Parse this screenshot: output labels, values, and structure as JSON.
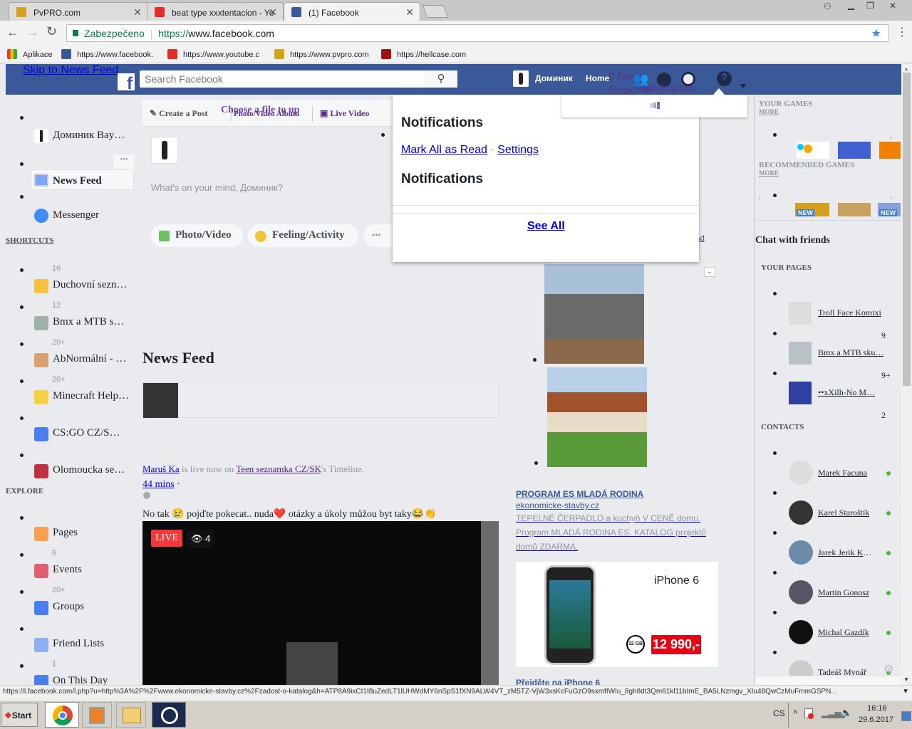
{
  "browser": {
    "tabs": [
      {
        "title": "PvPRO.com"
      },
      {
        "title": "beat type xxxtentacion - Yo"
      },
      {
        "title": "(1) Facebook"
      }
    ],
    "secure_label": "Zabezpečeno",
    "url_scheme": "https://",
    "url_rest": "www.facebook.com",
    "bookmarks": [
      {
        "label": "Aplikace"
      },
      {
        "label": "https://www.facebook."
      },
      {
        "label": "https://www.youtube.c"
      },
      {
        "label": "https://www.pvpro.com"
      },
      {
        "label": "https://hellcase.com"
      }
    ],
    "status_url": "https://l.facebook.com/l.php?u=http%3A%2F%2Fwww.ekonomicke-stavby.cz%2Fzadost-o-katalog&h=ATP8A9ixCI1t8uZedLT1lUHWdMY6nSpS1fXN9ALW4VT_zM5TZ-VjW3xsKcFuGzO9sxmfIWIu_8gh8dt3Qm61kl11bImE_BA5LNzmgv_XIu48QwCzMuFmmGSPN..."
  },
  "facebook": {
    "skip_link": "Skip to News Feed",
    "search_placeholder": "Search Facebook",
    "user_name": "Доминик",
    "home": "Home",
    "friend_requests_overlay": "0 Friend Requests",
    "notifications_overlay": "Notifications",
    "notifications": {
      "title": "Notifications",
      "mark_all": "Mark All as Read",
      "separator": " · ",
      "settings": "Settings",
      "subtitle": "Notifications",
      "see_all": "See All"
    },
    "composer": {
      "create_post": "Create a Post",
      "photo_album": "Photo/Video Album",
      "choose_file": "Choose a file to upload",
      "live_video": "Live Video",
      "placeholder": "What's on your mind, Доминик?",
      "photo_video": "Photo/Video",
      "feeling": "Feeling/Activity"
    },
    "left_nav": {
      "top": [
        {
          "label": "Доминик Bay…"
        },
        {
          "label": "News Feed"
        },
        {
          "label": "Messenger"
        }
      ],
      "shortcuts_title": "SHORTCUTS",
      "shortcuts": [
        {
          "count": "16",
          "label": "Duchovní sezn…"
        },
        {
          "count": "12",
          "label": "Bmx a MTB s…"
        },
        {
          "count": "20+",
          "label": "AbNormální - …"
        },
        {
          "count": "20+",
          "label": "Minecraft Help…"
        },
        {
          "count": "",
          "label": "CS:GO CZ/S…"
        },
        {
          "count": "",
          "label": "Olomoucka se…"
        }
      ],
      "explore_title": "EXPLORE",
      "explore": [
        {
          "count": "",
          "label": "Pages"
        },
        {
          "count": "6",
          "label": "Events"
        },
        {
          "count": "20+",
          "label": "Groups"
        },
        {
          "count": "",
          "label": "Friend Lists"
        },
        {
          "count": "1",
          "label": "On This Day"
        }
      ]
    },
    "feed": {
      "title": "News Feed",
      "post": {
        "author": "Maruš Ka",
        "middle": " is live now on ",
        "page": "Teen seznamka CZ/SK",
        "suffix": "'s Timeline.",
        "time": "44 mins",
        "time_sep": " ·",
        "text": "No tak 😢 pojďte pokecat.. nuda❤️ otázky a úkoly můžou byt taky😂👏",
        "live": "LIVE",
        "viewers": "4"
      }
    },
    "ad": {
      "create_ad": "Create Ad",
      "see_all": "See All",
      "title": "PROGRAM ES MLADÁ RODINA",
      "domain": "ekonomicke-stavby.cz",
      "text": "TEPELNÉ ČERPADLO a kuchyň V CENĚ domu. Program MLADÁ RODINA ES. KATALOG projektů domů ZDARMA.",
      "iphone_title": "iPhone 6",
      "storage": "32 GB",
      "price": "12 990,-",
      "next_title": "Přejděte na iPhone 6"
    },
    "right": {
      "your_games": "YOUR GAMES",
      "more": "MORE",
      "recommended": "RECOMMENDED GAMES",
      "new_badge": "NEW",
      "chat_title": "Chat with friends",
      "your_pages": "YOUR PAGES",
      "pages": [
        {
          "label": "Troll Face Komixi",
          "count": "9"
        },
        {
          "label": "Bmx a MTB sku…",
          "count": "9+"
        },
        {
          "label": "••xXilh-No M…",
          "count": "2"
        }
      ],
      "contacts_title": "CONTACTS",
      "contacts": [
        {
          "name": "Marek Facuna"
        },
        {
          "name": "Karel Staroštík"
        },
        {
          "name": "Jarek Jerik Krá…"
        },
        {
          "name": "Martin Gonosz"
        },
        {
          "name": "Michal Gazdík"
        },
        {
          "name": "Tadeáš Mynář"
        }
      ]
    }
  },
  "taskbar": {
    "start": "Start",
    "lang": "CS",
    "time": "16:16",
    "date": "29.6.2017"
  },
  "colors": {
    "fb_blue": "#3b5998",
    "bg": "#e9ebee",
    "online": "#42b72a",
    "live_red": "#f5393a",
    "price_red": "#e30613"
  }
}
